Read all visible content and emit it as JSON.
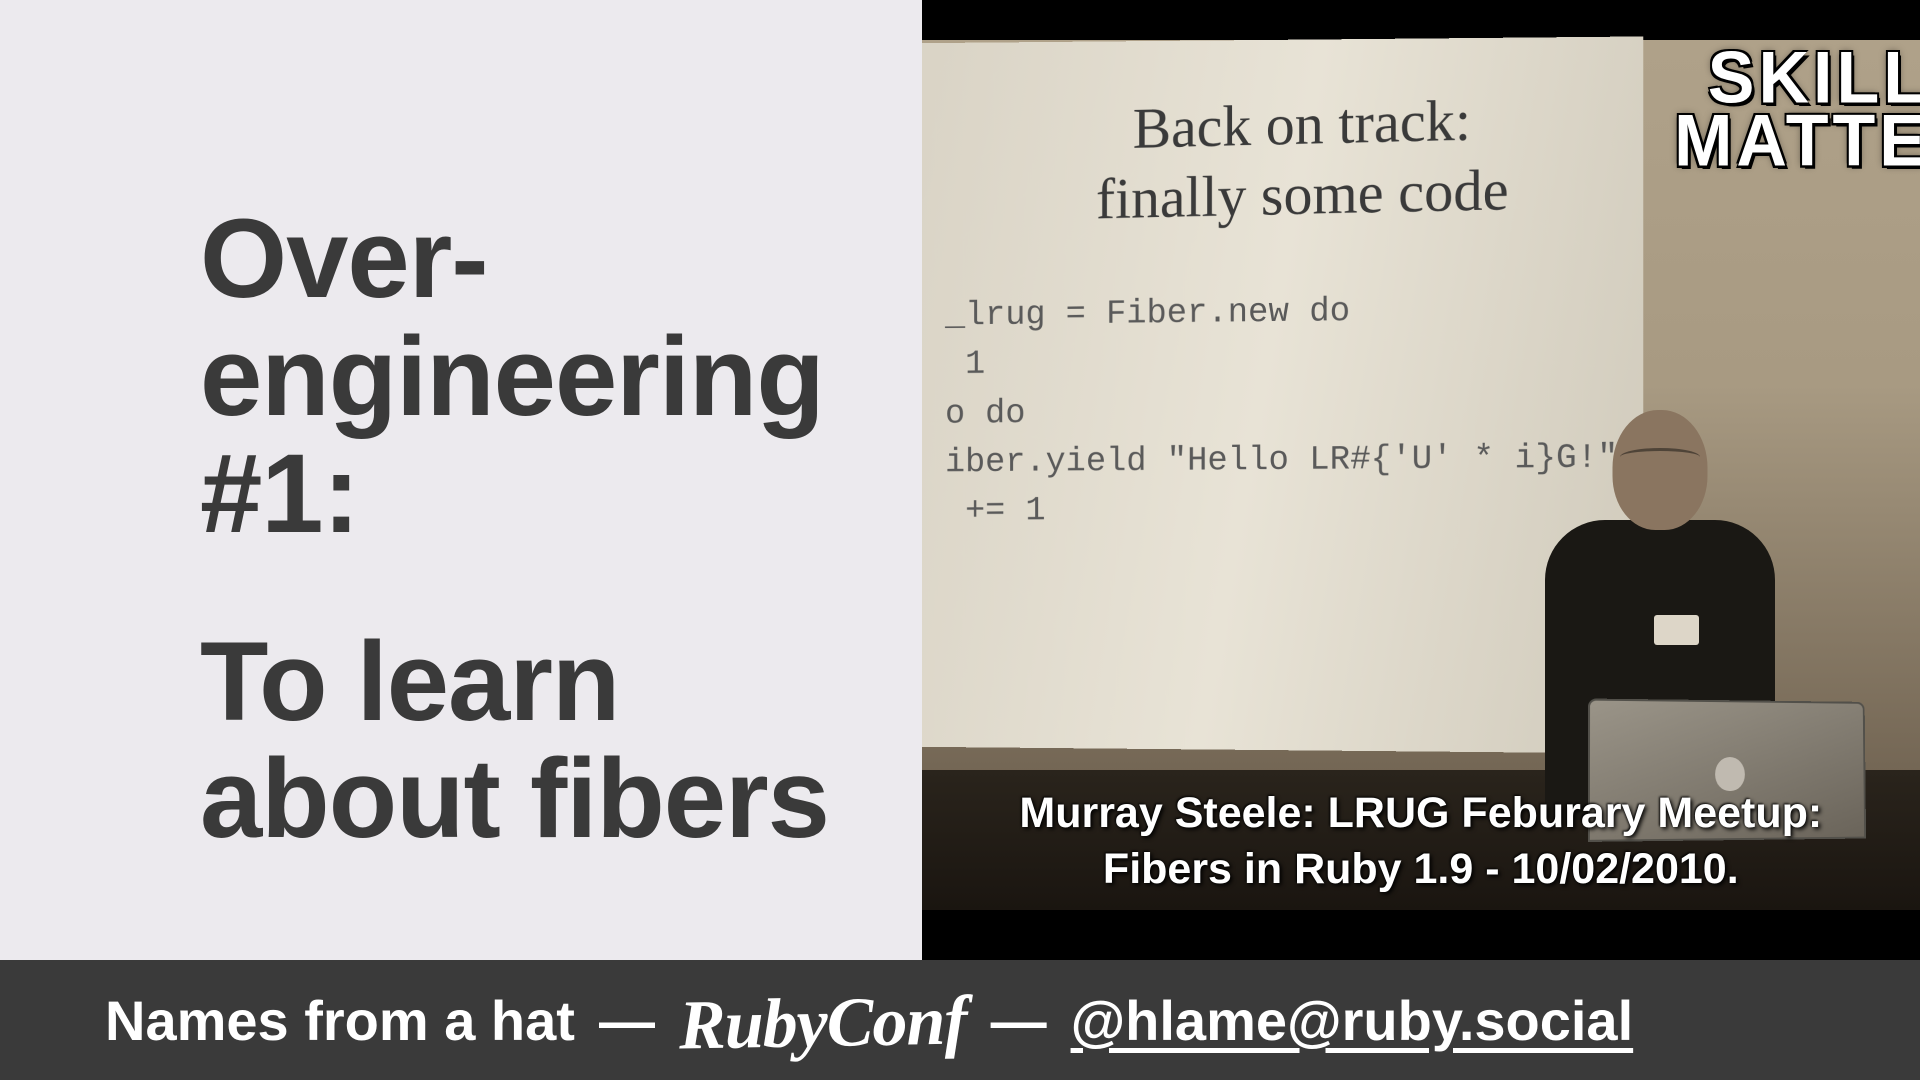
{
  "slide": {
    "heading_line1": "Over-engineering #1:",
    "heading_line2": "To learn about fibers"
  },
  "video": {
    "brand_line1": "SKILL",
    "brand_line2": "MATTE",
    "projected_title_line1": "Back on track:",
    "projected_title_line2": "finally some code",
    "projected_code": "_lrug = Fiber.new do\n 1\no do\niber.yield \"Hello LR#{'U' * i}G!\"\n += 1",
    "caption_line1": "Murray Steele: LRUG Feburary Meetup:",
    "caption_line2": "Fibers in Ruby 1.9 - 10/02/2010."
  },
  "footer": {
    "talk_title": "Names from a hat",
    "separator": "—",
    "conference": "RubyConf",
    "handle": "@hlame@ruby.social"
  }
}
